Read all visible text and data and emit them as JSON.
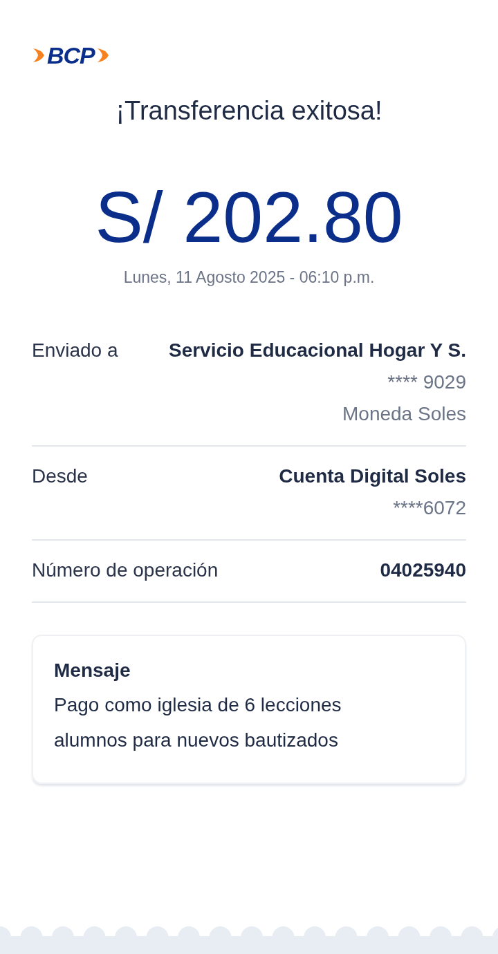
{
  "logo": {
    "text": "BCP"
  },
  "title": "¡Transferencia exitosa!",
  "amount": "S/ 202.80",
  "date": "Lunes, 11 Agosto 2025 - 06:10 p.m.",
  "details": [
    {
      "label": "Enviado a",
      "lines": [
        {
          "text": "Servicio Educacional Hogar Y S.",
          "kind": "primary"
        },
        {
          "text": "**** 9029",
          "kind": "secondary"
        },
        {
          "text": "Moneda Soles",
          "kind": "secondary"
        }
      ]
    },
    {
      "label": "Desde",
      "lines": [
        {
          "text": "Cuenta Digital Soles",
          "kind": "primary"
        },
        {
          "text": "****6072",
          "kind": "secondary"
        }
      ]
    },
    {
      "label": "Número de operación",
      "lines": [
        {
          "text": "04025940",
          "kind": "primary"
        }
      ]
    }
  ],
  "message": {
    "title": "Mensaje",
    "text": "Pago como iglesia de 6 lecciones alumnos para nuevos bautizados"
  }
}
